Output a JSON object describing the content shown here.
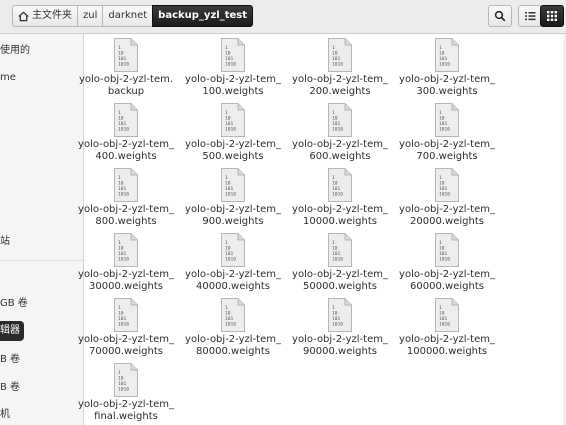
{
  "breadcrumb": {
    "items": [
      {
        "label": "主文件夹",
        "icon": "home-icon"
      },
      {
        "label": "zul"
      },
      {
        "label": "darknet"
      },
      {
        "label": "backup_yzl_test",
        "active": true
      }
    ]
  },
  "toolbar": {
    "search_icon": "search-icon",
    "list_view_icon": "list-view-icon",
    "grid_view_icon": "grid-view-icon"
  },
  "sidebar": {
    "items": [
      {
        "label": "使用的"
      },
      {
        "label": "me"
      },
      {
        "label": "站"
      },
      {
        "label": "GB 卷"
      },
      {
        "label": "辑器",
        "selected": true
      },
      {
        "label": "B 卷"
      },
      {
        "label": "B 卷"
      },
      {
        "label": "机"
      }
    ]
  },
  "files": [
    {
      "line1": "yolo-obj-2-yzl-tem.",
      "line2": "backup"
    },
    {
      "line1": "yolo-obj-2-yzl-tem_",
      "line2": "100.weights"
    },
    {
      "line1": "yolo-obj-2-yzl-tem_",
      "line2": "200.weights"
    },
    {
      "line1": "yolo-obj-2-yzl-tem_",
      "line2": "300.weights"
    },
    {
      "line1": "yolo-obj-2-yzl-tem_",
      "line2": "400.weights"
    },
    {
      "line1": "yolo-obj-2-yzl-tem_",
      "line2": "500.weights"
    },
    {
      "line1": "yolo-obj-2-yzl-tem_",
      "line2": "600.weights"
    },
    {
      "line1": "yolo-obj-2-yzl-tem_",
      "line2": "700.weights"
    },
    {
      "line1": "yolo-obj-2-yzl-tem_",
      "line2": "800.weights"
    },
    {
      "line1": "yolo-obj-2-yzl-tem_",
      "line2": "900.weights"
    },
    {
      "line1": "yolo-obj-2-yzl-tem_",
      "line2": "10000.weights"
    },
    {
      "line1": "yolo-obj-2-yzl-tem_",
      "line2": "20000.weights"
    },
    {
      "line1": "yolo-obj-2-yzl-tem_",
      "line2": "30000.weights"
    },
    {
      "line1": "yolo-obj-2-yzl-tem_",
      "line2": "40000.weights"
    },
    {
      "line1": "yolo-obj-2-yzl-tem_",
      "line2": "50000.weights"
    },
    {
      "line1": "yolo-obj-2-yzl-tem_",
      "line2": "60000.weights"
    },
    {
      "line1": "yolo-obj-2-yzl-tem_",
      "line2": "70000.weights"
    },
    {
      "line1": "yolo-obj-2-yzl-tem_",
      "line2": "80000.weights"
    },
    {
      "line1": "yolo-obj-2-yzl-tem_",
      "line2": "90000.weights"
    },
    {
      "line1": "yolo-obj-2-yzl-tem_",
      "line2": "100000.weights"
    },
    {
      "line1": "yolo-obj-2-yzl-tem_",
      "line2": "final.weights"
    }
  ],
  "file_icon": {
    "name": "binary-file-icon",
    "lines": [
      "1",
      "10",
      "101",
      "1010"
    ]
  },
  "colors": {
    "selected_bg": "#2b2b2b",
    "toolbar_bg": "#ececec",
    "sidebar_bg": "#f5f5f5"
  }
}
